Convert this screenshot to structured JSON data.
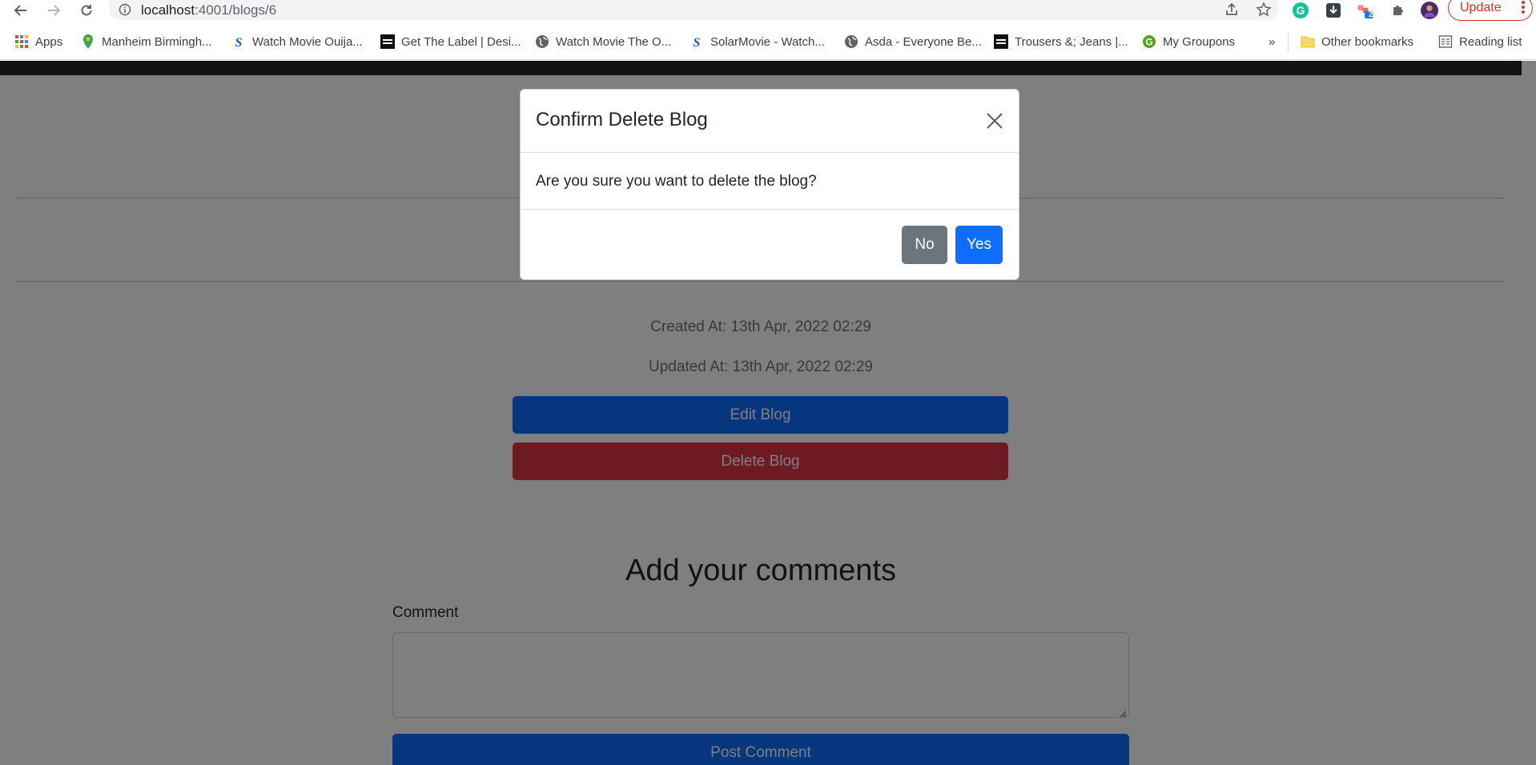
{
  "browser": {
    "url_host": "localhost",
    "url_path": ":4001/blogs/6",
    "update_label": "Update",
    "extension_badge": "2"
  },
  "bookmarks": {
    "items": [
      {
        "label": "Apps",
        "icon": "apps-grid-icon"
      },
      {
        "label": "Manheim Birmingh...",
        "icon": "maps-pin-icon"
      },
      {
        "label": "Watch Movie Ouija...",
        "icon": "solarmovie-icon"
      },
      {
        "label": "Get The Label | Desi...",
        "icon": "get-the-label-icon"
      },
      {
        "label": "Watch Movie The O...",
        "icon": "globe-icon"
      },
      {
        "label": "SolarMovie - Watch...",
        "icon": "solarmovie-icon"
      },
      {
        "label": "Asda - Everyone Be...",
        "icon": "globe-icon"
      },
      {
        "label": "Trousers &; Jeans |...",
        "icon": "get-the-label-icon"
      },
      {
        "label": "My Groupons",
        "icon": "groupon-icon"
      }
    ],
    "overflow": "»",
    "other_bookmarks": "Other bookmarks",
    "reading_list": "Reading list"
  },
  "blog": {
    "created_at": "Created At: 13th Apr, 2022 02:29",
    "updated_at": "Updated At: 13th Apr, 2022 02:29",
    "edit_label": "Edit Blog",
    "delete_label": "Delete Blog"
  },
  "comments": {
    "title": "Add your comments",
    "field_label": "Comment",
    "field_value": "",
    "submit_label": "Post Comment"
  },
  "modal": {
    "title": "Confirm Delete Blog",
    "body": "Are you sure you want to delete the blog?",
    "no_label": "No",
    "yes_label": "Yes"
  },
  "colors": {
    "primary": "#0d6efd",
    "danger": "#dc3545",
    "secondary": "#6c757d",
    "navbar": "#212529"
  }
}
